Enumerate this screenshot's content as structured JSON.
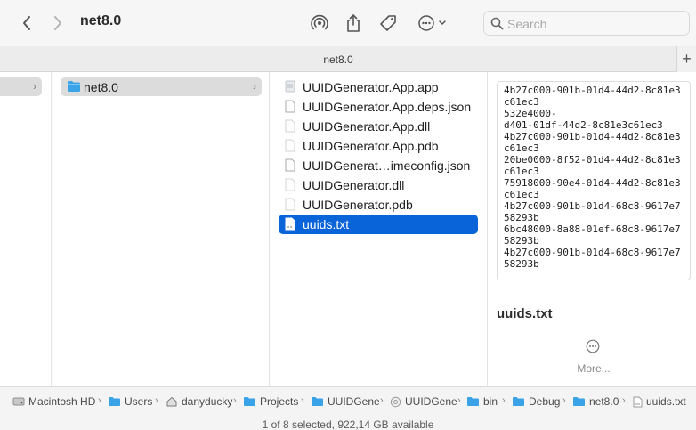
{
  "window": {
    "title": "net8.0"
  },
  "toolbar": {
    "back_icon": "chevron-left-icon",
    "forward_icon": "chevron-right-icon",
    "airdrop_icon": "airdrop-icon",
    "share_icon": "share-icon",
    "tag_icon": "tag-icon",
    "more_icon": "ellipsis-circle-icon"
  },
  "search": {
    "placeholder": "Search",
    "value": ""
  },
  "tab": {
    "label": "net8.0",
    "add_label": "+"
  },
  "columns": {
    "parent_folder": {
      "name": "net8.0"
    },
    "files": [
      {
        "name": "UUIDGenerator.App.app",
        "icon": "app-icon",
        "selected": false
      },
      {
        "name": "UUIDGenerator.App.deps.json",
        "icon": "document-icon",
        "selected": false
      },
      {
        "name": "UUIDGenerator.App.dll",
        "icon": "document-icon",
        "selected": false
      },
      {
        "name": "UUIDGenerator.App.pdb",
        "icon": "document-icon",
        "selected": false
      },
      {
        "name": "UUIDGenerat…imeconfig.json",
        "icon": "document-icon",
        "selected": false
      },
      {
        "name": "UUIDGenerator.dll",
        "icon": "document-icon",
        "selected": false
      },
      {
        "name": "UUIDGenerator.pdb",
        "icon": "document-icon",
        "selected": false
      },
      {
        "name": "uuids.txt",
        "icon": "text-document-icon",
        "selected": true
      }
    ]
  },
  "preview": {
    "lines": [
      "4b27c000-901b-01d4-44d2-8c81e3",
      "c61ec3",
      "532e4000-",
      "d401-01df-44d2-8c81e3c61ec3",
      "4b27c000-901b-01d4-44d2-8c81e3",
      "c61ec3",
      "20be0000-8f52-01d4-44d2-8c81e3",
      "c61ec3",
      "75918000-90e4-01d4-44d2-8c81e3",
      "c61ec3",
      "4b27c000-901b-01d4-68c8-9617e7",
      "58293b",
      "6bc48000-8a88-01ef-68c8-9617e7",
      "58293b",
      "4b27c000-901b-01d4-68c8-9617e7",
      "58293b"
    ],
    "file_name": "uuids.txt",
    "more_label": "More..."
  },
  "path": [
    {
      "label": "Macintosh HD",
      "icon": "disk-icon"
    },
    {
      "label": "Users",
      "icon": "folder-icon"
    },
    {
      "label": "danyducky",
      "icon": "home-icon"
    },
    {
      "label": "Projects",
      "icon": "folder-icon"
    },
    {
      "label": "UUIDGene",
      "icon": "folder-icon"
    },
    {
      "label": "UUIDGene",
      "icon": "project-icon"
    },
    {
      "label": "bin",
      "icon": "folder-icon"
    },
    {
      "label": "Debug",
      "icon": "folder-icon"
    },
    {
      "label": "net8.0",
      "icon": "folder-icon"
    },
    {
      "label": "uuids.txt",
      "icon": "text-document-icon"
    }
  ],
  "status": {
    "text": "1 of 8 selected, 922,14 GB available"
  },
  "colors": {
    "accent": "#0a64d9",
    "folder": "#3aa3e8"
  }
}
